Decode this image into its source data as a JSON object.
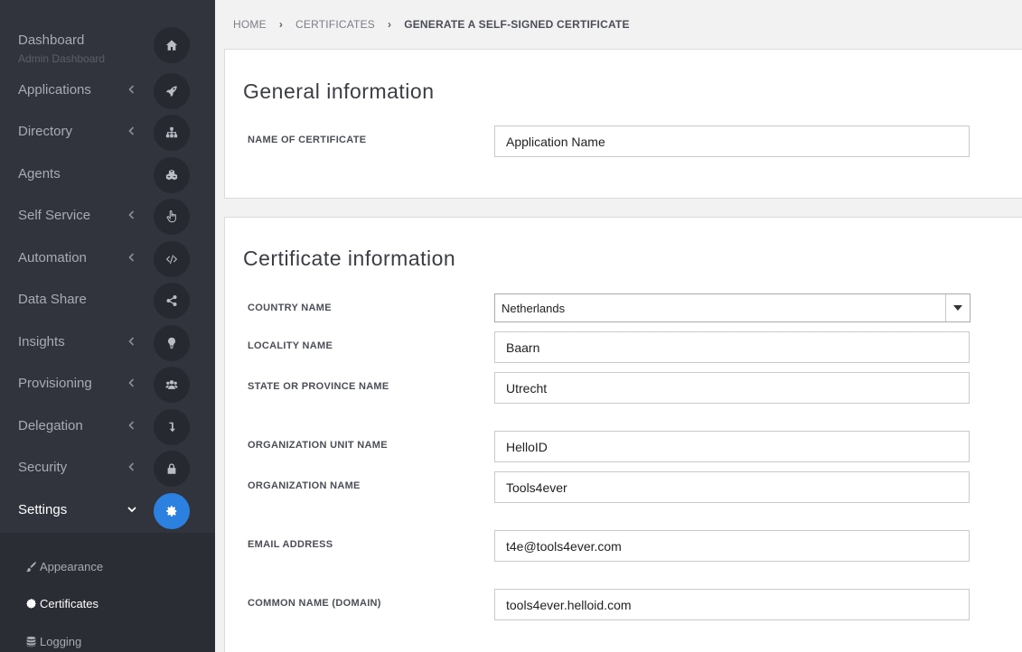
{
  "sidebar": {
    "items": [
      {
        "label": "Dashboard",
        "sublabel": "Admin Dashboard",
        "icon": "home-icon"
      },
      {
        "label": "Applications",
        "icon": "rocket-icon"
      },
      {
        "label": "Directory",
        "icon": "sitemap-icon"
      },
      {
        "label": "Agents",
        "icon": "cubes-icon"
      },
      {
        "label": "Self Service",
        "icon": "pointer-hand-icon"
      },
      {
        "label": "Automation",
        "icon": "code-icon"
      },
      {
        "label": "Data Share",
        "icon": "share-icon"
      },
      {
        "label": "Insights",
        "icon": "lightbulb-icon"
      },
      {
        "label": "Provisioning",
        "icon": "users-icon"
      },
      {
        "label": "Delegation",
        "icon": "arrow-down-icon"
      },
      {
        "label": "Security",
        "icon": "lock-icon"
      },
      {
        "label": "Settings",
        "icon": "gear-icon",
        "active": true
      }
    ],
    "submenu": [
      {
        "label": "Appearance",
        "icon": "brush-icon"
      },
      {
        "label": "Certificates",
        "icon": "certificate-icon",
        "active": true
      },
      {
        "label": "Logging",
        "icon": "database-icon"
      }
    ]
  },
  "breadcrumb": [
    "HOME",
    "CERTIFICATES",
    "GENERATE A SELF-SIGNED CERTIFICATE"
  ],
  "general": {
    "title": "General information",
    "name_label": "NAME OF CERTIFICATE",
    "name_value": "Application Name"
  },
  "certificate": {
    "title": "Certificate information",
    "country_label": "COUNTRY NAME",
    "country_value": "Netherlands",
    "locality_label": "LOCALITY NAME",
    "locality_value": "Baarn",
    "state_label": "STATE OR PROVINCE NAME",
    "state_value": "Utrecht",
    "org_unit_label": "ORGANIZATION UNIT NAME",
    "org_unit_value": "HelloID",
    "org_label": "ORGANIZATION NAME",
    "org_value": "Tools4ever",
    "email_label": "EMAIL ADDRESS",
    "email_value": "t4e@tools4ever.com",
    "cn_label": "COMMON NAME (DOMAIN)",
    "cn_value": "tools4ever.helloid.com"
  },
  "colors": {
    "sidebar_bg": "#31343d",
    "accent": "#2c80df"
  }
}
